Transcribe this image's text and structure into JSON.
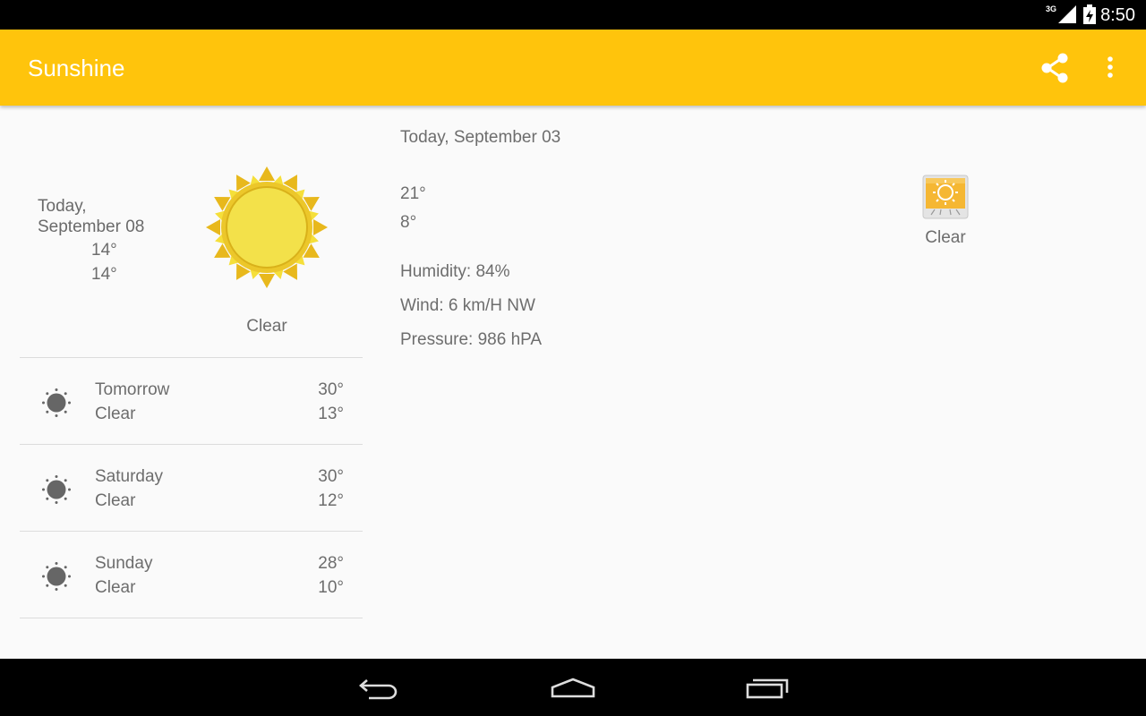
{
  "status_bar": {
    "network": "3G",
    "time": "8:50",
    "icons": [
      "signal-icon",
      "battery-icon"
    ]
  },
  "app_bar": {
    "title": "Sunshine",
    "actions": [
      "share-icon",
      "overflow-menu-icon"
    ],
    "color": "#ffc40c"
  },
  "today": {
    "date": "Today, September 08",
    "high": "14°",
    "low": "14°",
    "description": "Clear",
    "icon": "sun-icon"
  },
  "forecast": [
    {
      "day": "Tomorrow",
      "description": "Clear",
      "high": "30°",
      "low": "13°",
      "icon": "clear-icon"
    },
    {
      "day": "Saturday",
      "description": "Clear",
      "high": "30°",
      "low": "12°",
      "icon": "clear-icon"
    },
    {
      "day": "Sunday",
      "description": "Clear",
      "high": "28°",
      "low": "10°",
      "icon": "clear-icon"
    }
  ],
  "detail": {
    "date": "Today, September 03",
    "high": "21°",
    "low": "8°",
    "humidity": "Humidity: 84%",
    "wind": "Wind: 6 km/H NW",
    "pressure": "Pressure: 986 hPA",
    "description": "Clear",
    "icon": "weather-image-icon"
  },
  "nav_bar": {
    "buttons": [
      "back-icon",
      "home-icon",
      "recents-icon"
    ]
  }
}
